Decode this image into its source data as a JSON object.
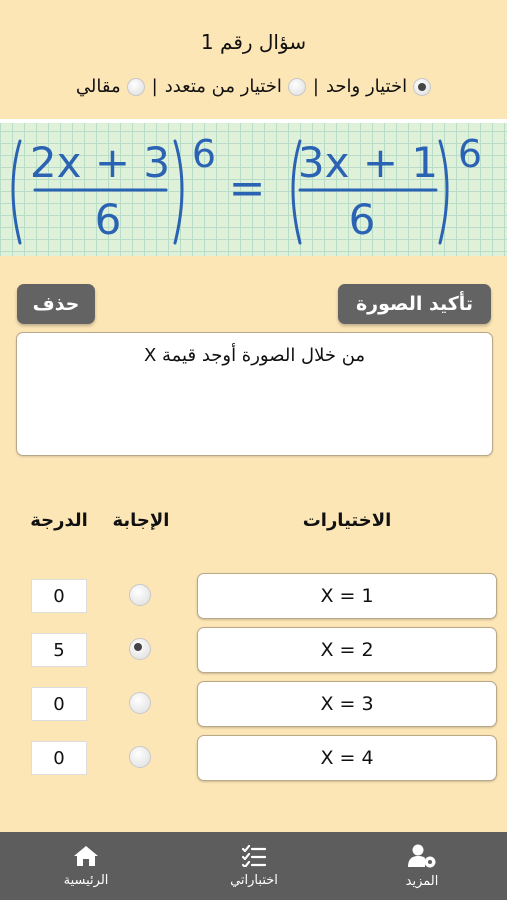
{
  "question": {
    "title": "سؤال رقم 1",
    "types": [
      {
        "label": "اختيار واحد",
        "selected": true
      },
      {
        "label": "اختيار من متعدد",
        "selected": false
      },
      {
        "label": "مقالي",
        "selected": false
      }
    ],
    "separator": "|",
    "equation": {
      "left_numerator": "2x + 3",
      "left_denominator": "6",
      "exponent": "6",
      "equals": "=",
      "right_numerator": "3x + 1",
      "right_denominator": "6"
    },
    "delete_label": "حذف",
    "confirm_image_label": "تأكيد الصورة",
    "text": "من خلال الصورة أوجد قيمة X"
  },
  "columns": {
    "choices": "الاختيارات",
    "answer": "الإجابة",
    "grade": "الدرجة"
  },
  "rows": [
    {
      "choice": "X = 1",
      "grade": "0",
      "correct": false
    },
    {
      "choice": "X = 2",
      "grade": "5",
      "correct": true
    },
    {
      "choice": "X = 3",
      "grade": "0",
      "correct": false
    },
    {
      "choice": "X = 4",
      "grade": "0",
      "correct": false
    }
  ],
  "nav": {
    "home": {
      "label": "الرئيسية",
      "icon": "home-icon"
    },
    "tests": {
      "label": "اختباراتي",
      "icon": "checklist-icon"
    },
    "more": {
      "label": "المزيد",
      "icon": "user-gear-icon"
    }
  },
  "colors": {
    "background": "#fde6b6",
    "button": "#636363",
    "nav": "#5d5d5d",
    "equation_ink": "#2b63b4"
  }
}
